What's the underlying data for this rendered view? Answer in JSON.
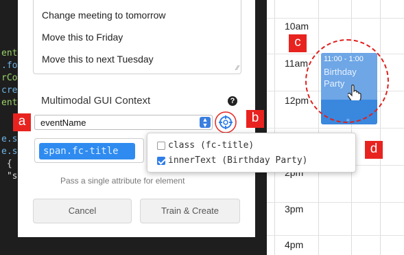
{
  "code_editor": {
    "lines": [
      {
        "text": "ent",
        "color": "#9bd36a"
      },
      {
        "text": ".fo",
        "color": "#6fb5e8"
      },
      {
        "text": "rCo",
        "color": "#9bd36a"
      },
      {
        "text": "cre",
        "color": "#6fb5e8"
      },
      {
        "text": "ent",
        "color": "#9bd36a"
      },
      {
        "text": "e.s",
        "color": "#6fb5e8"
      },
      {
        "text": "e.s",
        "color": "#6fb5e8"
      },
      {
        "text": " {",
        "color": "#dddddd"
      },
      {
        "text": " \"s",
        "color": "#dddddd"
      }
    ]
  },
  "dialog": {
    "commands": [
      "Change meeting to tomorrow",
      "Move this to Friday",
      "Move this to next Tuesday"
    ],
    "section_title": "Multimodal GUI Context",
    "help_icon": "?",
    "select_value": "eventName",
    "attribute_chip": "span.fc-title",
    "hint": "Pass a single attribute for element",
    "cancel_label": "Cancel",
    "train_label": "Train & Create"
  },
  "popup": {
    "options": [
      {
        "label": "class (fc-title)",
        "checked": false
      },
      {
        "label": "innerText (Birthday Party)",
        "checked": true
      }
    ]
  },
  "calendar": {
    "times": [
      "10am",
      "11am",
      "12pm",
      "2pm",
      "3pm",
      "4pm"
    ],
    "event": {
      "time": "11:00 - 1:00",
      "title": "Birthday Party",
      "resize_handle": "="
    }
  },
  "annotations": [
    "a",
    "b",
    "c",
    "d"
  ],
  "colors": {
    "accent_blue": "#2f8bf0",
    "annotation_red": "#e8231f",
    "event_blue": "#3a87de"
  }
}
